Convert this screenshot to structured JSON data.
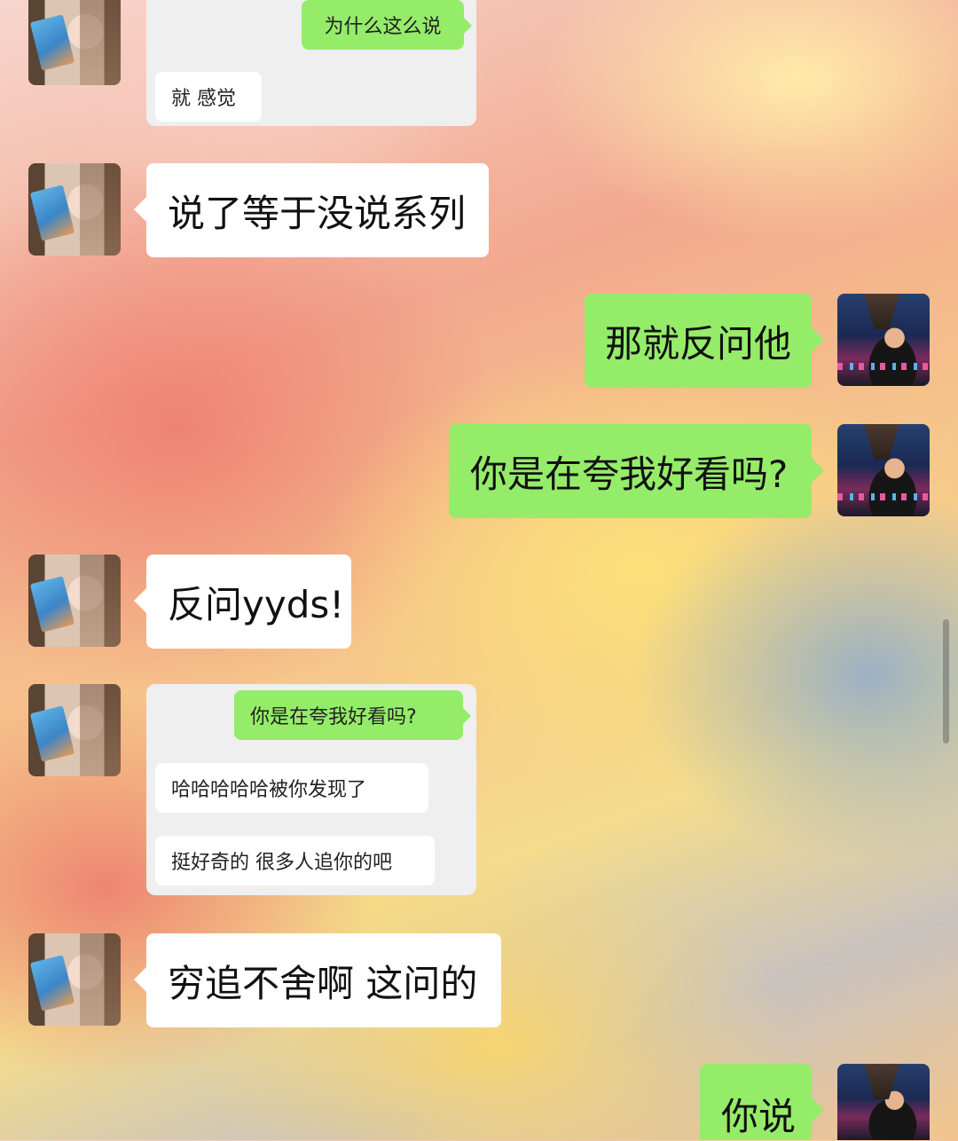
{
  "messages": {
    "m1_screenshot": {
      "sent": "为什么这么说",
      "received": "就 感觉"
    },
    "m2": "说了等于没说系列",
    "m3": "那就反问他",
    "m4": "你是在夸我好看吗?",
    "m5": "反问yyds!",
    "m6_screenshot": {
      "sent": "你是在夸我好看吗?",
      "received_1": "哈哈哈哈哈被你发现了",
      "received_2": "挺好奇的 很多人追你的吧"
    },
    "m7": "穷追不舍啊 这问的",
    "m8": "你说"
  },
  "colors": {
    "sent_bubble": "#95ec69",
    "received_bubble": "#ffffff",
    "screenshot_card": "#efefef"
  },
  "icons": {
    "left_avatar": "avatar-girl-holding-card",
    "right_avatar": "avatar-woman-night-city"
  }
}
